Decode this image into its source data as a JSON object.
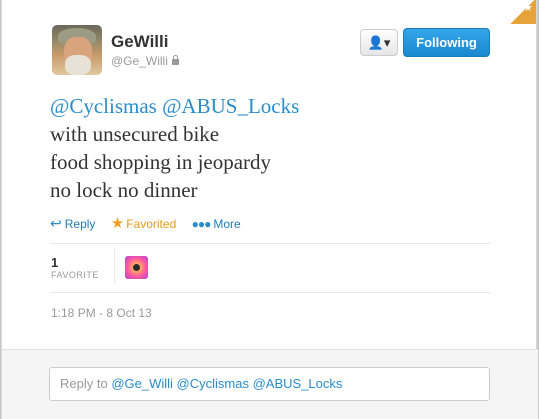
{
  "tweet": {
    "display_name": "GeWilli",
    "handle": "@Ge_Willi",
    "text_lines": [
      [
        "@Cyclismas",
        "@ABUS_Locks"
      ],
      "with unsecured bike",
      "food shopping in jeopardy",
      "no lock no dinner"
    ],
    "follow_label": "Following",
    "user_menu_icon": "person-dropdown-icon",
    "actions": {
      "reply": "Reply",
      "favorited": "Favorited",
      "more": "More"
    },
    "favorite_count": "1",
    "favorite_label": "FAVORITE",
    "timestamp": "1:18 PM - 8 Oct 13",
    "reply_prefix": "Reply to",
    "reply_mentions": [
      "@Ge_Willi",
      "@Cyclismas",
      "@ABUS_Locks"
    ]
  },
  "colors": {
    "link": "#2a8dc9",
    "follow_button": "#1a88d0",
    "favorite_star": "#f0a020"
  }
}
